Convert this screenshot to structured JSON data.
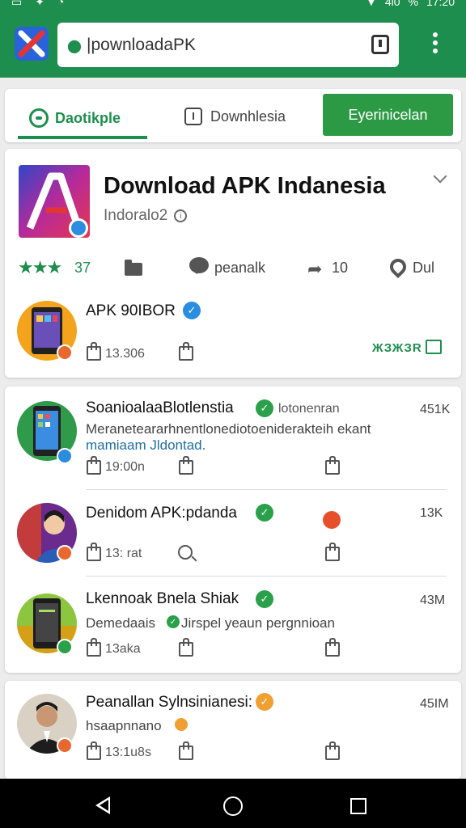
{
  "status_bar": {
    "time": "17:20",
    "battery": "%",
    "signal": "4l0"
  },
  "browser": {
    "url": "|pownloadaPK"
  },
  "tabs": {
    "tab1": "Daotikple",
    "tab2": "Downhlesia",
    "button": "Eyerinicelan"
  },
  "app": {
    "title": "Download APK Indanesia",
    "subtitle": "Indoralo2",
    "rating_count": "37",
    "stat_comment": "peanalk",
    "stat_share": "10",
    "stat_loc": "Dul",
    "colors": {
      "green": "#1e8e4e",
      "button_green": "#2c9a44",
      "verified_blue": "#2a8de0"
    }
  },
  "featured_post": {
    "title": "APK 90IBOR",
    "likes": "13.306",
    "share_label": "ЖЗЖЗR"
  },
  "posts": [
    {
      "title": "SoanioalaaBlotlenstia",
      "meta": "lotonenran",
      "count": "451K",
      "body": "Meraneteararhnentlonediotoeniderakteih ekant",
      "link": "mamiaam Jldontad.",
      "likes": "19:00n"
    },
    {
      "title": "Denidom APK:pdanda",
      "meta": "",
      "count": "13K",
      "body": "",
      "link": "",
      "likes": "13: rat"
    },
    {
      "title": "Lkennoak Bnela Shiak",
      "meta": "",
      "count": "43M",
      "body": "Demedaais",
      "body2": "Jirspel yeaun pergnnioan",
      "link": "",
      "likes": "13aka"
    },
    {
      "title": "Peanallan Sylnsinianesi:",
      "meta": "",
      "count": "45IM",
      "body": "hsaapnnano",
      "link": "",
      "likes": "13:1u8s"
    }
  ]
}
